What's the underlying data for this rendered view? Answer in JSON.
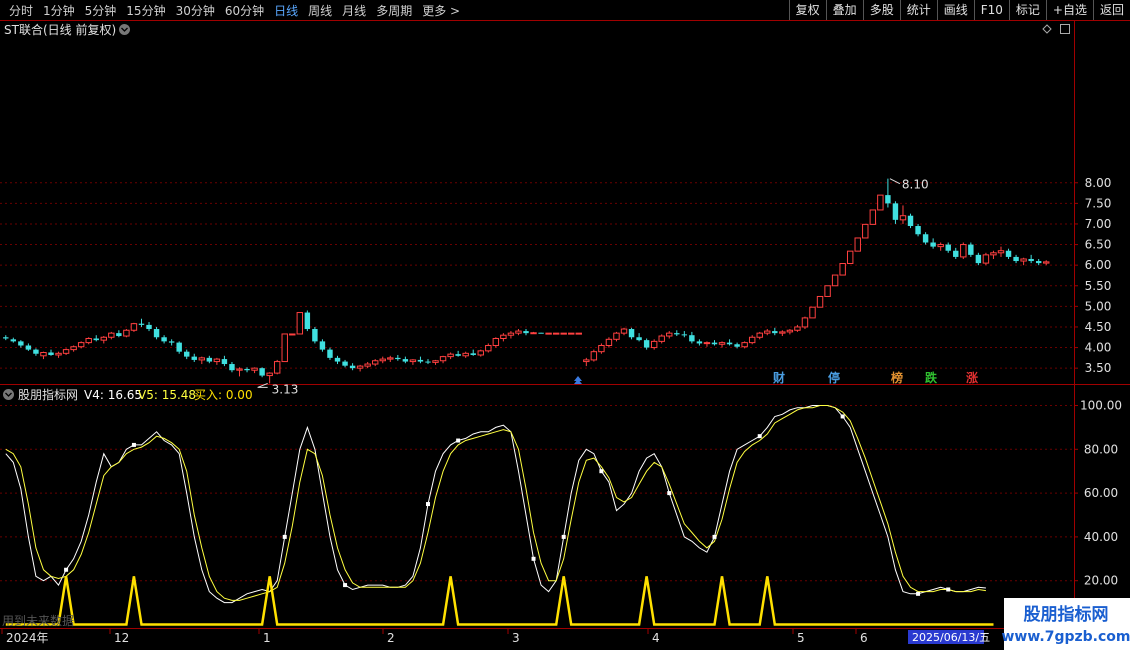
{
  "toolbar": {
    "periods": [
      "分时",
      "1分钟",
      "5分钟",
      "15分钟",
      "30分钟",
      "60分钟",
      "日线",
      "周线",
      "月线",
      "多周期",
      "更多 >"
    ],
    "active_period": "日线",
    "buttons": [
      "复权",
      "叠加",
      "多股",
      "统计",
      "画线",
      "F10",
      "标记",
      "+自选",
      "返回"
    ]
  },
  "main_panel": {
    "title": "ST联合(日线 前复权)",
    "max_label": "8.10",
    "min_label": "3.13",
    "y_ticks": [
      "8.00",
      "7.50",
      "7.00",
      "6.50",
      "6.00",
      "5.50",
      "5.00",
      "4.50",
      "4.00",
      "3.50"
    ],
    "event_markers": [
      {
        "label": "财",
        "color": "#4a9de0"
      },
      {
        "label": "停",
        "color": "#4a9de0"
      },
      {
        "label": "榜",
        "color": "#e09030"
      },
      {
        "label": "跌",
        "color": "#30c030"
      },
      {
        "label": "涨",
        "color": "#e03030"
      }
    ]
  },
  "indicator_panel": {
    "title": "股朋指标网",
    "v4_label": "V4: 16.65",
    "v5_label": "V5: 15.48",
    "buy_label": "买入: 0.00",
    "y_ticks": [
      "100.00",
      "80.00",
      "60.00",
      "40.00",
      "20.00"
    ]
  },
  "x_axis": {
    "labels": [
      "2024年",
      "12",
      "1",
      "2",
      "3",
      "4",
      "5",
      "6"
    ],
    "cursor_date": "2025/06/13/五"
  },
  "watermark": {
    "title": "股朋指标网",
    "url": "www.7gpzb.com"
  },
  "footer_note": "用到未来数据",
  "chart_data": [
    {
      "type": "candlestick",
      "title": "ST联合(日线 前复权)",
      "ylim": [
        3.0,
        8.3
      ],
      "annotations": [
        {
          "text": "8.10",
          "value": 8.1
        },
        {
          "text": "3.13",
          "value": 3.13
        }
      ],
      "candles": [
        [
          4.25,
          4.3,
          4.18,
          4.22
        ],
        [
          4.2,
          4.24,
          4.12,
          4.15
        ],
        [
          4.15,
          4.18,
          4.0,
          4.05
        ],
        [
          4.05,
          4.1,
          3.92,
          3.95
        ],
        [
          3.95,
          3.98,
          3.8,
          3.85
        ],
        [
          3.8,
          3.9,
          3.72,
          3.88
        ],
        [
          3.88,
          3.95,
          3.8,
          3.82
        ],
        [
          3.82,
          3.9,
          3.75,
          3.86
        ],
        [
          3.86,
          3.98,
          3.82,
          3.95
        ],
        [
          3.95,
          4.05,
          3.9,
          4.02
        ],
        [
          4.02,
          4.15,
          3.98,
          4.12
        ],
        [
          4.12,
          4.25,
          4.08,
          4.22
        ],
        [
          4.22,
          4.3,
          4.15,
          4.18
        ],
        [
          4.18,
          4.28,
          4.1,
          4.25
        ],
        [
          4.25,
          4.38,
          4.2,
          4.35
        ],
        [
          4.35,
          4.42,
          4.25,
          4.28
        ],
        [
          4.28,
          4.45,
          4.25,
          4.42
        ],
        [
          4.42,
          4.6,
          4.38,
          4.58
        ],
        [
          4.58,
          4.7,
          4.5,
          4.55
        ],
        [
          4.55,
          4.62,
          4.4,
          4.45
        ],
        [
          4.45,
          4.5,
          4.2,
          4.25
        ],
        [
          4.25,
          4.3,
          4.1,
          4.15
        ],
        [
          4.15,
          4.2,
          4.05,
          4.12
        ],
        [
          4.12,
          4.15,
          3.85,
          3.9
        ],
        [
          3.9,
          3.95,
          3.72,
          3.78
        ],
        [
          3.78,
          3.85,
          3.65,
          3.7
        ],
        [
          3.7,
          3.78,
          3.6,
          3.75
        ],
        [
          3.75,
          3.8,
          3.62,
          3.66
        ],
        [
          3.66,
          3.75,
          3.58,
          3.72
        ],
        [
          3.72,
          3.8,
          3.55,
          3.6
        ],
        [
          3.6,
          3.65,
          3.4,
          3.45
        ],
        [
          3.45,
          3.52,
          3.3,
          3.48
        ],
        [
          3.48,
          3.52,
          3.4,
          3.45
        ],
        [
          3.45,
          3.52,
          3.38,
          3.5
        ],
        [
          3.5,
          3.52,
          3.28,
          3.32
        ],
        [
          3.32,
          3.4,
          3.13,
          3.38
        ],
        [
          3.38,
          3.7,
          3.35,
          3.66
        ],
        [
          3.66,
          4.33,
          3.66,
          4.33
        ],
        [
          4.33,
          4.33,
          4.33,
          4.33
        ],
        [
          4.33,
          4.85,
          4.33,
          4.85
        ],
        [
          4.85,
          4.9,
          4.4,
          4.45
        ],
        [
          4.45,
          4.5,
          4.1,
          4.15
        ],
        [
          4.15,
          4.2,
          3.9,
          3.95
        ],
        [
          3.95,
          4.0,
          3.7,
          3.75
        ],
        [
          3.75,
          3.8,
          3.6,
          3.66
        ],
        [
          3.66,
          3.7,
          3.52,
          3.56
        ],
        [
          3.56,
          3.62,
          3.45,
          3.5
        ],
        [
          3.5,
          3.58,
          3.42,
          3.55
        ],
        [
          3.55,
          3.65,
          3.5,
          3.6
        ],
        [
          3.6,
          3.72,
          3.55,
          3.68
        ],
        [
          3.68,
          3.78,
          3.62,
          3.72
        ],
        [
          3.72,
          3.8,
          3.65,
          3.75
        ],
        [
          3.75,
          3.82,
          3.68,
          3.72
        ],
        [
          3.72,
          3.78,
          3.62,
          3.66
        ],
        [
          3.66,
          3.72,
          3.58,
          3.7
        ],
        [
          3.7,
          3.78,
          3.62,
          3.66
        ],
        [
          3.66,
          3.72,
          3.6,
          3.64
        ],
        [
          3.64,
          3.7,
          3.58,
          3.68
        ],
        [
          3.68,
          3.8,
          3.62,
          3.78
        ],
        [
          3.78,
          3.88,
          3.72,
          3.84
        ],
        [
          3.84,
          3.92,
          3.78,
          3.8
        ],
        [
          3.8,
          3.9,
          3.75,
          3.86
        ],
        [
          3.86,
          3.95,
          3.8,
          3.82
        ],
        [
          3.82,
          3.95,
          3.78,
          3.92
        ],
        [
          3.92,
          4.1,
          3.88,
          4.05
        ],
        [
          4.05,
          4.25,
          4.0,
          4.22
        ],
        [
          4.22,
          4.35,
          4.15,
          4.3
        ],
        [
          4.3,
          4.4,
          4.22,
          4.35
        ],
        [
          4.35,
          4.45,
          4.3,
          4.4
        ],
        [
          4.4,
          4.45,
          4.3,
          4.35
        ],
        [
          4.35,
          4.38,
          4.35,
          4.36
        ],
        [
          4.36,
          4.36,
          4.35,
          4.35
        ],
        [
          4.35,
          4.35,
          4.35,
          4.35
        ],
        [
          4.35,
          4.35,
          4.35,
          4.35
        ],
        [
          4.35,
          4.35,
          4.35,
          4.35
        ],
        [
          4.35,
          4.35,
          4.35,
          4.35
        ],
        [
          4.35,
          4.35,
          4.35,
          4.35
        ],
        [
          3.66,
          3.75,
          3.55,
          3.7
        ],
        [
          3.7,
          3.95,
          3.66,
          3.9
        ],
        [
          3.9,
          4.1,
          3.85,
          4.05
        ],
        [
          4.05,
          4.25,
          4.0,
          4.2
        ],
        [
          4.2,
          4.38,
          4.15,
          4.35
        ],
        [
          4.35,
          4.48,
          4.3,
          4.45
        ],
        [
          4.45,
          4.48,
          4.2,
          4.25
        ],
        [
          4.25,
          4.35,
          4.15,
          4.18
        ],
        [
          4.18,
          4.22,
          3.95,
          4.0
        ],
        [
          4.0,
          4.2,
          3.95,
          4.15
        ],
        [
          4.15,
          4.32,
          4.1,
          4.28
        ],
        [
          4.28,
          4.4,
          4.22,
          4.35
        ],
        [
          4.35,
          4.42,
          4.28,
          4.32
        ],
        [
          4.32,
          4.4,
          4.25,
          4.3
        ],
        [
          4.3,
          4.38,
          4.1,
          4.15
        ],
        [
          4.15,
          4.2,
          4.05,
          4.1
        ],
        [
          4.1,
          4.15,
          4.02,
          4.12
        ],
        [
          4.12,
          4.18,
          4.05,
          4.08
        ],
        [
          4.08,
          4.15,
          4.0,
          4.12
        ],
        [
          4.12,
          4.2,
          4.05,
          4.08
        ],
        [
          4.08,
          4.12,
          3.98,
          4.02
        ],
        [
          4.02,
          4.15,
          3.98,
          4.12
        ],
        [
          4.12,
          4.3,
          4.08,
          4.25
        ],
        [
          4.25,
          4.38,
          4.2,
          4.35
        ],
        [
          4.35,
          4.45,
          4.3,
          4.4
        ],
        [
          4.4,
          4.48,
          4.3,
          4.35
        ],
        [
          4.35,
          4.42,
          4.28,
          4.38
        ],
        [
          4.38,
          4.45,
          4.32,
          4.42
        ],
        [
          4.42,
          4.55,
          4.38,
          4.5
        ],
        [
          4.5,
          4.75,
          4.45,
          4.72
        ],
        [
          4.72,
          4.98,
          4.72,
          4.98
        ],
        [
          4.98,
          5.24,
          4.98,
          5.24
        ],
        [
          5.24,
          5.5,
          5.24,
          5.5
        ],
        [
          5.5,
          5.76,
          5.5,
          5.76
        ],
        [
          5.76,
          6.04,
          5.76,
          6.04
        ],
        [
          6.04,
          6.34,
          6.04,
          6.34
        ],
        [
          6.34,
          6.66,
          6.34,
          6.66
        ],
        [
          6.66,
          6.99,
          6.66,
          6.99
        ],
        [
          6.99,
          7.34,
          6.99,
          7.34
        ],
        [
          7.34,
          7.7,
          7.34,
          7.7
        ],
        [
          7.7,
          8.1,
          7.4,
          7.5
        ],
        [
          7.5,
          7.55,
          7.0,
          7.1
        ],
        [
          7.1,
          7.45,
          7.0,
          7.2
        ],
        [
          7.2,
          7.25,
          6.9,
          6.95
        ],
        [
          6.95,
          7.0,
          6.7,
          6.75
        ],
        [
          6.75,
          6.8,
          6.5,
          6.55
        ],
        [
          6.55,
          6.65,
          6.4,
          6.45
        ],
        [
          6.45,
          6.55,
          6.35,
          6.5
        ],
        [
          6.5,
          6.55,
          6.3,
          6.35
        ],
        [
          6.35,
          6.42,
          6.15,
          6.2
        ],
        [
          6.2,
          6.55,
          6.15,
          6.5
        ],
        [
          6.5,
          6.55,
          6.2,
          6.25
        ],
        [
          6.25,
          6.3,
          6.0,
          6.05
        ],
        [
          6.05,
          6.3,
          6.0,
          6.25
        ],
        [
          6.25,
          6.35,
          6.15,
          6.3
        ],
        [
          6.3,
          6.45,
          6.2,
          6.35
        ],
        [
          6.35,
          6.4,
          6.15,
          6.2
        ],
        [
          6.2,
          6.25,
          6.05,
          6.1
        ],
        [
          6.1,
          6.18,
          6.0,
          6.15
        ],
        [
          6.15,
          6.25,
          6.05,
          6.1
        ],
        [
          6.1,
          6.15,
          6.0,
          6.05
        ],
        [
          6.05,
          6.12,
          6.0,
          6.08
        ]
      ]
    },
    {
      "type": "line",
      "title": "股朋指标网",
      "ylim": [
        0,
        105
      ],
      "series": [
        {
          "name": "V4",
          "color": "#ffffff",
          "values": [
            78,
            74,
            62,
            40,
            22,
            20,
            22,
            18,
            25,
            30,
            38,
            50,
            65,
            78,
            72,
            74,
            80,
            82,
            82,
            85,
            88,
            84,
            82,
            78,
            60,
            40,
            25,
            15,
            12,
            10,
            10,
            12,
            14,
            15,
            16,
            15,
            20,
            40,
            60,
            80,
            90,
            80,
            60,
            40,
            25,
            18,
            16,
            17,
            18,
            18,
            18,
            17,
            17,
            18,
            22,
            35,
            55,
            70,
            78,
            82,
            84,
            85,
            87,
            88,
            88,
            90,
            91,
            88,
            70,
            50,
            30,
            18,
            15,
            20,
            40,
            60,
            75,
            80,
            78,
            70,
            65,
            52,
            55,
            60,
            70,
            76,
            78,
            72,
            60,
            50,
            40,
            38,
            35,
            33,
            40,
            55,
            70,
            80,
            82,
            84,
            86,
            90,
            95,
            96,
            98,
            99,
            99,
            100,
            100,
            100,
            99,
            95,
            90,
            80,
            70,
            60,
            50,
            40,
            25,
            15,
            14,
            14,
            15,
            16,
            17,
            16,
            15,
            15,
            16,
            17,
            16.65
          ]
        },
        {
          "name": "V5",
          "color": "#ffff40",
          "values": [
            80,
            78,
            72,
            55,
            35,
            25,
            22,
            21,
            22,
            25,
            32,
            42,
            55,
            68,
            72,
            74,
            78,
            80,
            81,
            83,
            86,
            85,
            83,
            80,
            70,
            50,
            35,
            22,
            15,
            12,
            11,
            11,
            12,
            13,
            14,
            15,
            17,
            28,
            45,
            65,
            80,
            78,
            68,
            50,
            35,
            25,
            19,
            17,
            17,
            17,
            17,
            17,
            17,
            17,
            20,
            28,
            42,
            58,
            70,
            78,
            82,
            84,
            85,
            86,
            87,
            88,
            89,
            88,
            80,
            62,
            42,
            28,
            20,
            20,
            30,
            48,
            65,
            75,
            76,
            72,
            67,
            58,
            56,
            58,
            64,
            70,
            74,
            72,
            64,
            55,
            46,
            42,
            38,
            35,
            38,
            48,
            62,
            74,
            79,
            82,
            84,
            87,
            92,
            94,
            96,
            98,
            99,
            99,
            100,
            100,
            99,
            97,
            93,
            85,
            76,
            66,
            56,
            46,
            33,
            22,
            17,
            15,
            15,
            15,
            16,
            16,
            15,
            15,
            15,
            16,
            15.48
          ]
        },
        {
          "name": "买入",
          "color": "#ffe000",
          "values": [
            0,
            0,
            0,
            0,
            0,
            0,
            0,
            0,
            22,
            0,
            0,
            0,
            0,
            0,
            0,
            0,
            0,
            22,
            0,
            0,
            0,
            0,
            0,
            0,
            0,
            0,
            0,
            0,
            0,
            0,
            0,
            0,
            0,
            0,
            0,
            22,
            0,
            0,
            0,
            0,
            0,
            0,
            0,
            0,
            0,
            0,
            0,
            0,
            0,
            0,
            0,
            0,
            0,
            0,
            0,
            0,
            0,
            0,
            0,
            22,
            0,
            0,
            0,
            0,
            0,
            0,
            0,
            0,
            0,
            0,
            0,
            0,
            0,
            0,
            22,
            0,
            0,
            0,
            0,
            0,
            0,
            0,
            0,
            0,
            0,
            22,
            0,
            0,
            0,
            0,
            0,
            0,
            0,
            0,
            0,
            22,
            0,
            0,
            0,
            0,
            0,
            22,
            0,
            0,
            0,
            0,
            0,
            0,
            0,
            0,
            0,
            0,
            0,
            0,
            0,
            0,
            0,
            0,
            0,
            0,
            0,
            0,
            0,
            0,
            0,
            0,
            0,
            0,
            0,
            0,
            0,
            0
          ]
        }
      ]
    }
  ]
}
